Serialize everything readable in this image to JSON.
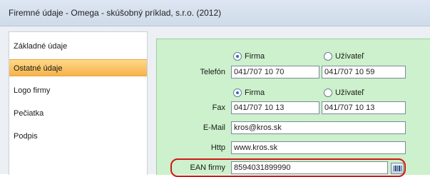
{
  "window": {
    "title": "Firemné údaje - Omega - skúšobný príklad, s.r.o. (2012)"
  },
  "sidebar": {
    "items": [
      {
        "label": "Základné údaje"
      },
      {
        "label": "Ostatné údaje"
      },
      {
        "label": "Logo firmy"
      },
      {
        "label": "Pečiatka"
      },
      {
        "label": "Podpis"
      }
    ],
    "selected": "Ostatné údaje"
  },
  "form": {
    "phone": {
      "label": "Telefón",
      "radio_firma": "Firma",
      "radio_uzivatel": "Užívateľ",
      "selected": "Firma",
      "value_firma": "041/707 10 70",
      "value_uzivatel": "041/707 10 59"
    },
    "fax": {
      "label": "Fax",
      "radio_firma": "Firma",
      "radio_uzivatel": "Užívateľ",
      "selected": "Firma",
      "value_firma": "041/707 10 13",
      "value_uzivatel": "041/707 10 13"
    },
    "email": {
      "label": "E-Mail",
      "value": "kros@kros.sk"
    },
    "http": {
      "label": "Http",
      "value": "www.kros.sk"
    },
    "ean": {
      "label": "EAN firmy",
      "value": "8594031899990"
    }
  },
  "colors": {
    "highlight": "#d01818",
    "panel": "#ccf1cc",
    "selected_item": "#f6b24a"
  }
}
